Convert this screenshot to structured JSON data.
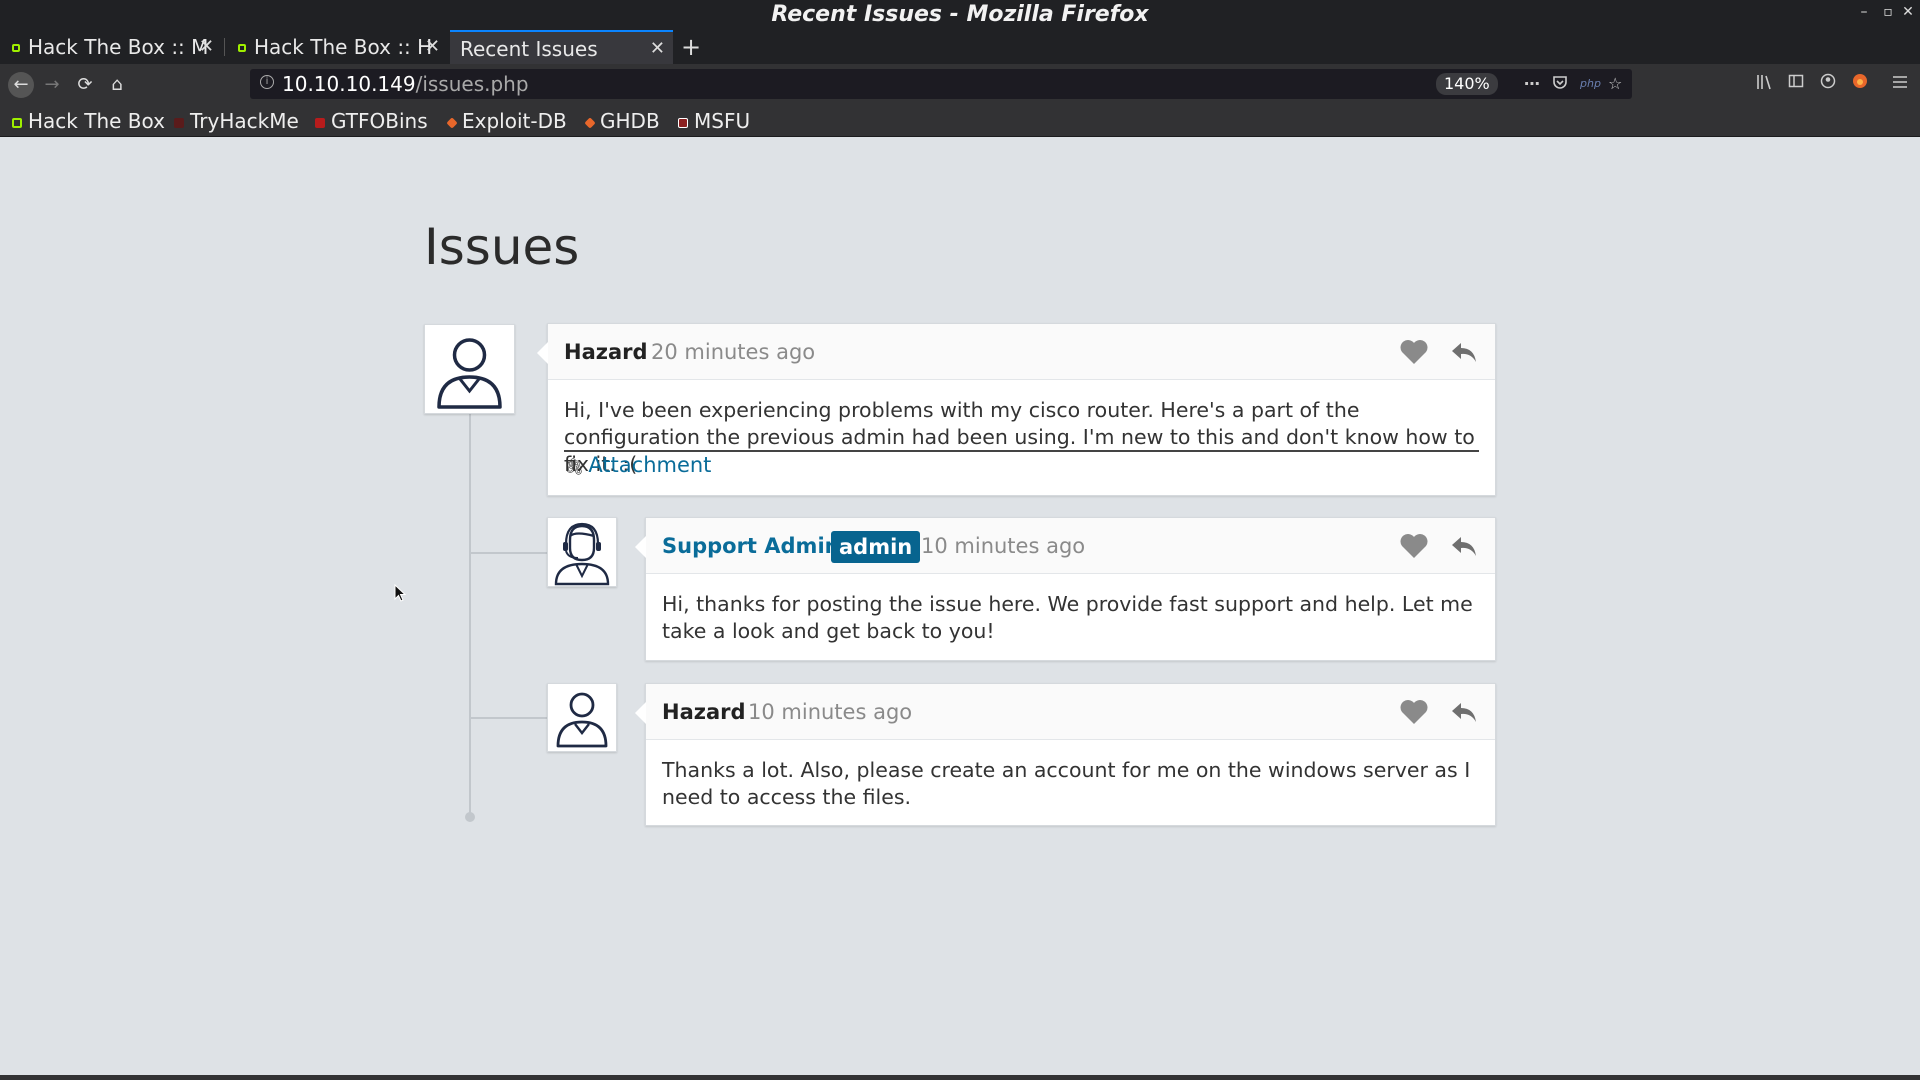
{
  "window": {
    "title": "Recent Issues - Mozilla Firefox",
    "controls": {
      "minimize": "–",
      "maximize": "▫",
      "close": "✕"
    }
  },
  "tabs": [
    {
      "label": "Hack The Box :: M",
      "active": false
    },
    {
      "label": "Hack The Box :: H",
      "active": false
    },
    {
      "label": "Recent Issues",
      "active": true
    }
  ],
  "tab_close": "✕",
  "new_tab": "+",
  "navigation": {
    "back": "←",
    "forward": "→",
    "reload": "⟳",
    "home": "⌂",
    "url_host": "10.10.10.149",
    "url_path": "/issues.php",
    "zoom": "140%",
    "more": "⋯",
    "php_label": "php"
  },
  "bookmarks": [
    {
      "label": "Hack The Box",
      "color": "#9fef00"
    },
    {
      "label": "TryHackMe",
      "color": "#c11111"
    },
    {
      "label": "GTFOBins",
      "color": "#b71c1c"
    },
    {
      "label": "Exploit-DB",
      "color": "#e8672b"
    },
    {
      "label": "GHDB",
      "color": "#e8672b"
    },
    {
      "label": "MSFU",
      "color": "#ffffff"
    }
  ],
  "page": {
    "title": "Issues",
    "accent_color": "#0a6c99",
    "badge_color": "#07648f",
    "posts": [
      {
        "author": "Hazard",
        "time": "20 minutes ago",
        "body": "Hi, I've been experiencing problems with my cisco router. Here's a part of the configuration the previous admin had been using. I'm new to this and don't know how to fix it. :(",
        "attachment": "Attachment",
        "avatar": "user-icon"
      },
      {
        "author": "Support Admin",
        "badge": "admin",
        "time": "10 minutes ago",
        "body": "Hi, thanks for posting the issue here. We provide fast support and help. Let me take a look and get back to you!",
        "avatar": "support-agent-icon"
      },
      {
        "author": "Hazard",
        "time": "10 minutes ago",
        "body": "Thanks a lot. Also, please create an account for me on the windows server as I need to access the files.",
        "avatar": "user-icon"
      }
    ]
  }
}
